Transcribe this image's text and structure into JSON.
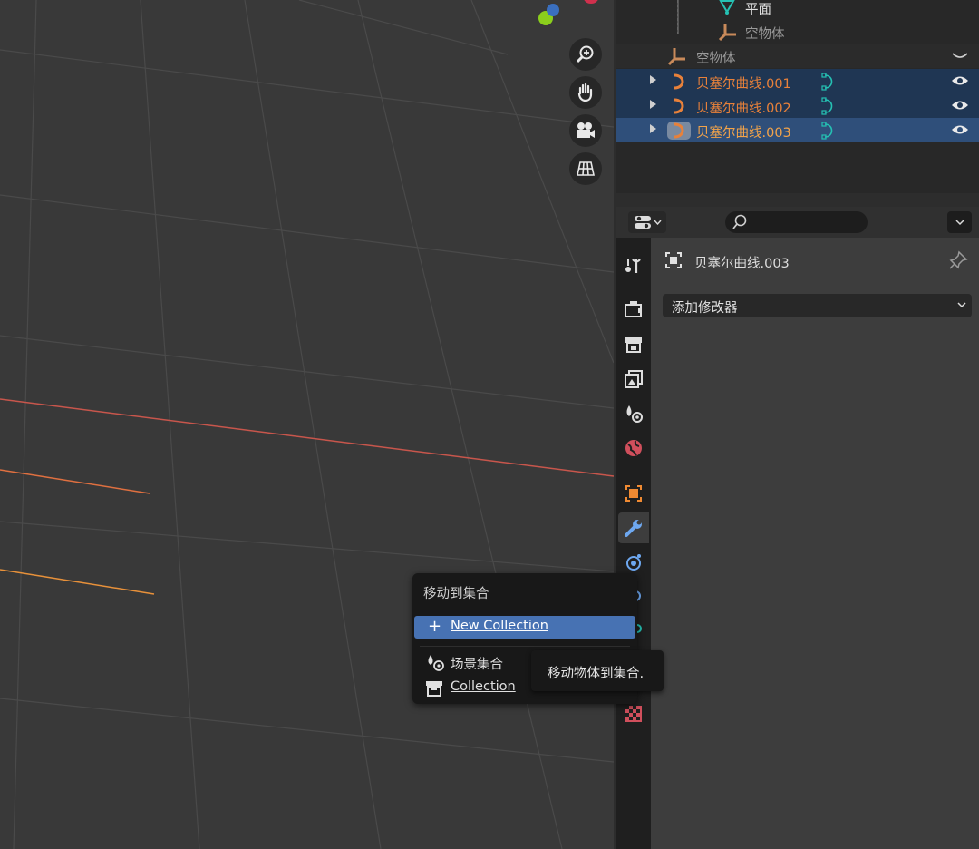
{
  "viewport": {
    "nav_buttons": [
      {
        "icon": "zoom-in-icon"
      },
      {
        "icon": "hand-pan-icon"
      },
      {
        "icon": "camera-view-icon"
      },
      {
        "icon": "ortho-grid-icon"
      }
    ]
  },
  "outliner": {
    "rows": [
      {
        "label": "平面",
        "icon": "mesh-data-icon"
      },
      {
        "label": "空物体",
        "icon": "empty-icon"
      },
      {
        "label": "空物体",
        "icon": "empty-icon"
      },
      {
        "label": "贝塞尔曲线.001",
        "icon": "curve-icon",
        "selected": true
      },
      {
        "label": "贝塞尔曲线.002",
        "icon": "curve-icon",
        "selected": true
      },
      {
        "label": "贝塞尔曲线.003",
        "icon": "curve-icon",
        "selected": true,
        "active": true
      }
    ]
  },
  "properties": {
    "object_name": "贝塞尔曲线.003",
    "add_modifier_label": "添加修改器",
    "tabs": [
      "tool-icon",
      "render-icon",
      "output-icon",
      "view-layer-icon",
      "scene-icon",
      "world-icon",
      "object-icon",
      "modifier-icon",
      "particles-icon",
      "physics-icon",
      "constraints-icon",
      "data-icon",
      "texture-icon"
    ]
  },
  "menu": {
    "title": "移动到集合",
    "items": [
      {
        "label": "New Collection",
        "icon": "plus-icon",
        "highlighted": true
      },
      {
        "label": "场景集合",
        "icon": "scene-collection-icon"
      },
      {
        "label": "Collection",
        "icon": "collection-icon"
      }
    ]
  },
  "tooltip": {
    "text": "移动物体到集合."
  },
  "colors": {
    "selected_row": "#1f3653",
    "active_row": "#2f4f7a",
    "menu_highlight": "#4772b3",
    "curve_orange": "#e8813a",
    "modifier_teal": "#25c1b3"
  }
}
